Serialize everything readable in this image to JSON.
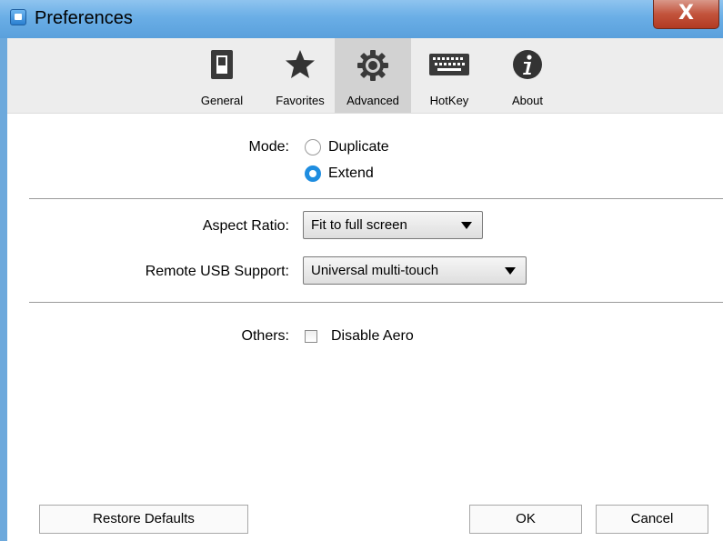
{
  "window": {
    "title": "Preferences",
    "close_glyph": "X"
  },
  "toolbar": {
    "items": [
      {
        "label": "General",
        "icon": "switch-icon",
        "selected": false
      },
      {
        "label": "Favorites",
        "icon": "star-icon",
        "selected": false
      },
      {
        "label": "Advanced",
        "icon": "gear-icon",
        "selected": true
      },
      {
        "label": "HotKey",
        "icon": "keyboard-icon",
        "selected": false
      },
      {
        "label": "About",
        "icon": "info-icon",
        "selected": false
      }
    ]
  },
  "mode": {
    "label": "Mode:",
    "options": [
      {
        "label": "Duplicate",
        "checked": false
      },
      {
        "label": "Extend",
        "checked": true
      }
    ]
  },
  "aspect_ratio": {
    "label": "Aspect Ratio:",
    "value": "Fit to full screen"
  },
  "remote_usb": {
    "label": "Remote USB Support:",
    "value": "Universal multi-touch"
  },
  "others": {
    "label": "Others:",
    "checkbox_label": "Disable Aero",
    "checked": false
  },
  "buttons": {
    "restore": "Restore Defaults",
    "ok": "OK",
    "cancel": "Cancel"
  },
  "colors": {
    "titlebar": "#6aaee6",
    "radio_selected": "#1f8de0",
    "close_button": "#c2533c",
    "toolbar_selected": "#d2d2d2"
  }
}
